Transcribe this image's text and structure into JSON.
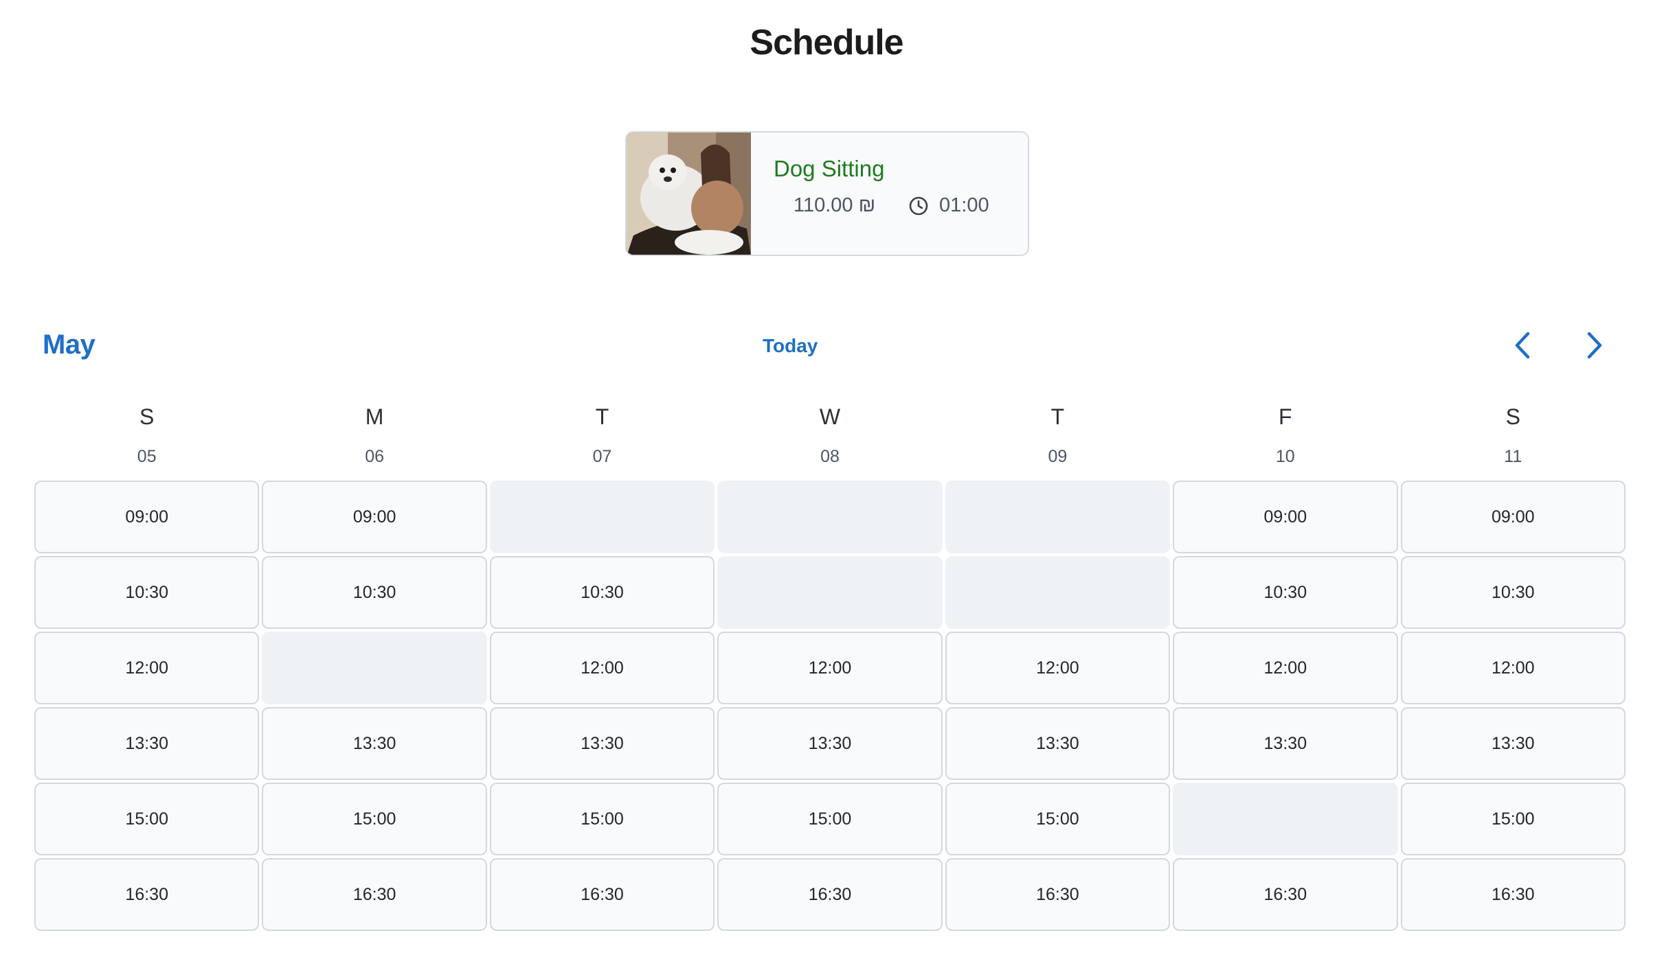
{
  "page": {
    "title": "Schedule"
  },
  "service": {
    "name": "Dog Sitting",
    "price": "110.00 ₪",
    "duration": "01:00",
    "image_icon": "dog-photo"
  },
  "calendar": {
    "month": "May",
    "today_label": "Today",
    "prev_icon": "chevron-left-icon",
    "next_icon": "chevron-right-icon",
    "accent_color": "#1f6fc4",
    "days": [
      {
        "letter": "S",
        "date": "05",
        "slots": [
          "09:00",
          "10:30",
          "12:00",
          "13:30",
          "15:00",
          "16:30"
        ]
      },
      {
        "letter": "M",
        "date": "06",
        "slots": [
          "09:00",
          "10:30",
          "",
          "13:30",
          "15:00",
          "16:30"
        ]
      },
      {
        "letter": "T",
        "date": "07",
        "slots": [
          "",
          "10:30",
          "12:00",
          "13:30",
          "15:00",
          "16:30"
        ]
      },
      {
        "letter": "W",
        "date": "08",
        "slots": [
          "",
          "",
          "12:00",
          "13:30",
          "15:00",
          "16:30"
        ]
      },
      {
        "letter": "T",
        "date": "09",
        "slots": [
          "",
          "",
          "12:00",
          "13:30",
          "15:00",
          "16:30"
        ]
      },
      {
        "letter": "F",
        "date": "10",
        "slots": [
          "09:00",
          "10:30",
          "12:00",
          "13:30",
          "",
          "16:30"
        ]
      },
      {
        "letter": "S",
        "date": "11",
        "slots": [
          "09:00",
          "10:30",
          "12:00",
          "13:30",
          "15:00",
          "16:30"
        ]
      }
    ]
  }
}
